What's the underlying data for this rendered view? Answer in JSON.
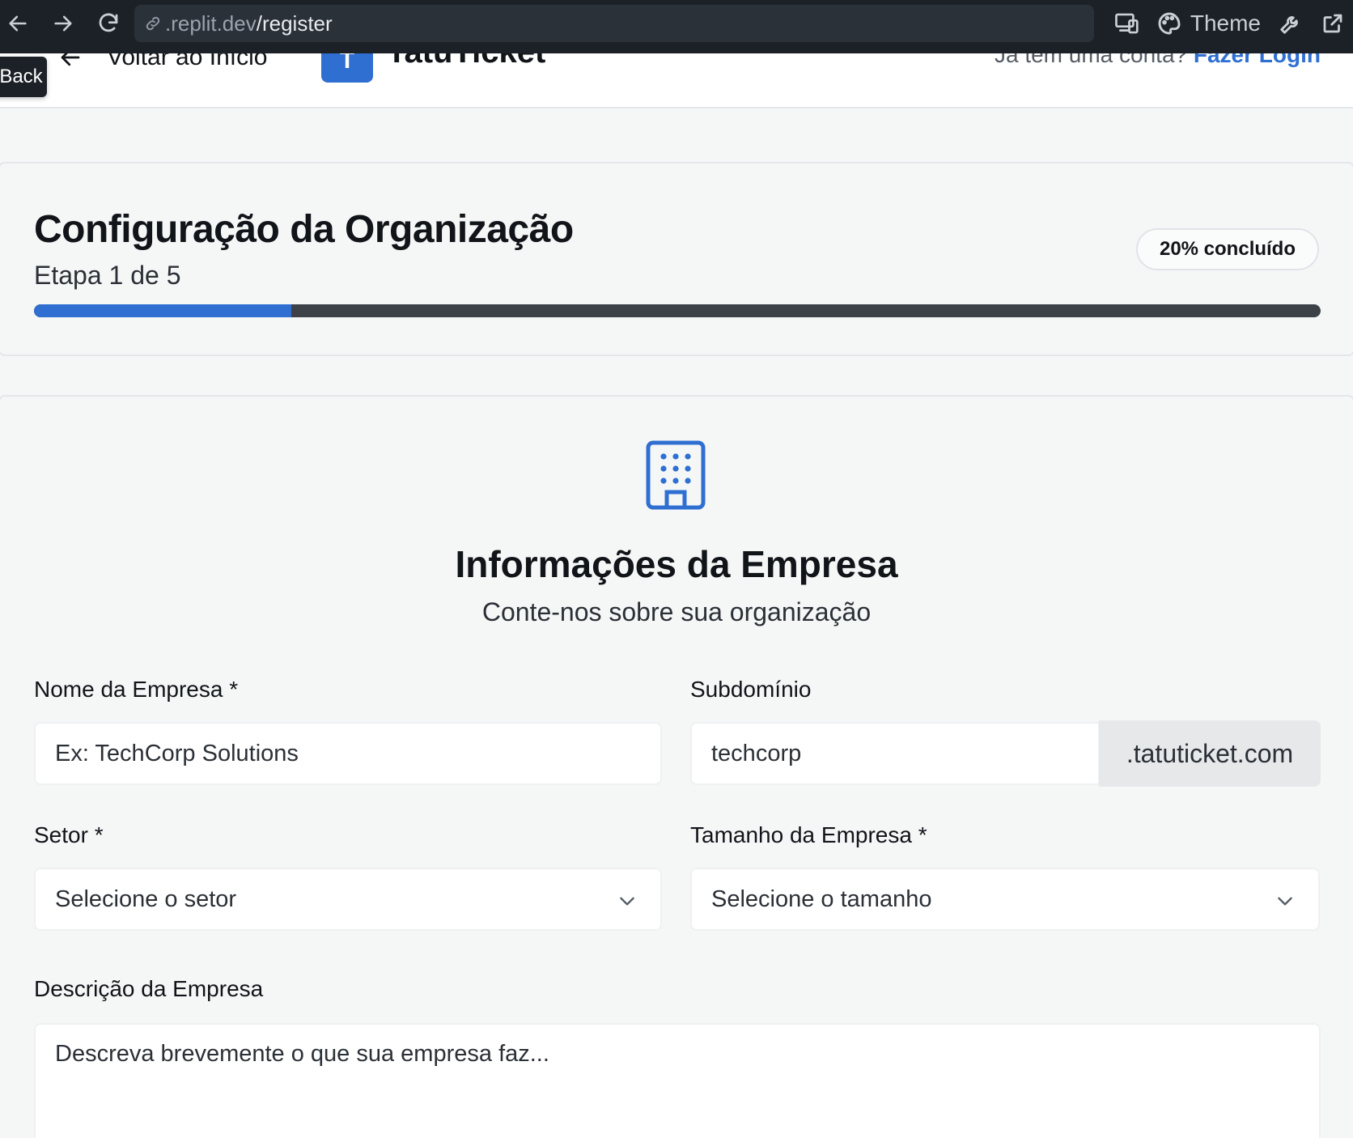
{
  "browser": {
    "url_host": ".replit.dev",
    "url_path": "/register",
    "theme_label": "Theme"
  },
  "header": {
    "back_link": "Voltar ao Início",
    "logo_letter": "T",
    "brand": "TatuTicket",
    "login_prompt": "Já tem uma conta?",
    "login_link": "Fazer Login",
    "back_tab": "Back"
  },
  "progress": {
    "title": "Configuração da Organização",
    "step": "Etapa 1 de 5",
    "badge": "20% concluído",
    "fraction": 0.2,
    "accent": "#2f6fd1"
  },
  "form": {
    "icon": "building-icon",
    "title": "Informações da Empresa",
    "subtitle": "Conte-nos sobre sua organização",
    "company_name_label": "Nome da Empresa *",
    "company_name_placeholder": "Ex: TechCorp Solutions",
    "subdomain_label": "Subdomínio",
    "subdomain_value": "techcorp",
    "subdomain_suffix": ".tatuticket.com",
    "sector_label": "Setor *",
    "sector_value": "Selecione o setor",
    "size_label": "Tamanho da Empresa *",
    "size_value": "Selecione o tamanho",
    "description_label": "Descrição da Empresa",
    "description_placeholder": "Descreva brevemente o que sua empresa faz..."
  }
}
